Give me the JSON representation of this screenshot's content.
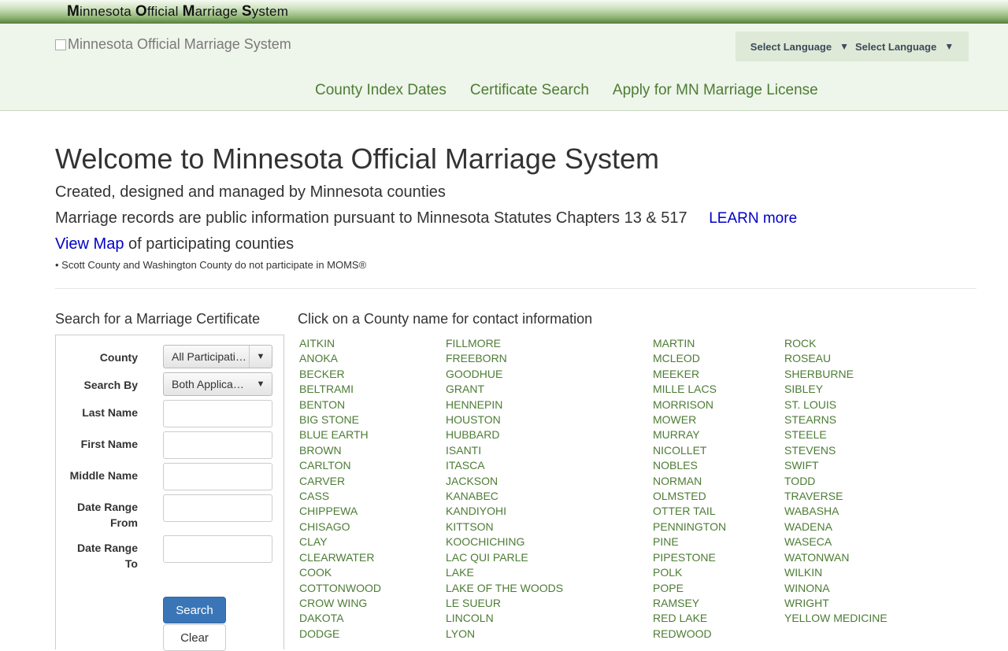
{
  "topbar": {
    "title_parts": [
      {
        "cap": "M",
        "rest": "innesota "
      },
      {
        "cap": "O",
        "rest": "fficial "
      },
      {
        "cap": "M",
        "rest": "arriage "
      },
      {
        "cap": "S",
        "rest": "ystem"
      }
    ]
  },
  "header": {
    "logo_alt": "Minnesota Official Marriage System",
    "language": {
      "select_1": "Select Language",
      "select_2": "Select Language"
    },
    "nav": [
      "County Index Dates",
      "Certificate Search",
      "Apply for MN Marriage License"
    ]
  },
  "welcome": {
    "title": "Welcome to Minnesota Official Marriage System",
    "line1": "Created, designed and managed by Minnesota counties",
    "line2": "Marriage records are public information pursuant to Minnesota Statutes Chapters 13 & 517",
    "learn_more": "LEARN more",
    "view_map": "View Map",
    "view_map_suffix": " of participating counties",
    "note": "• Scott County and Washington County do not participate in MOMS®"
  },
  "search": {
    "title": "Search for a Marriage Certificate",
    "county_label": "County",
    "county_value": "All Participating Counties",
    "search_by_label": "Search By",
    "search_by_value": "Both Applicants",
    "last_name_label": "Last Name",
    "first_name_label": "First Name",
    "middle_name_label": "Middle Name",
    "date_from_label_1": "Date Range",
    "date_from_label_2": "From",
    "date_to_label_1": "Date Range",
    "date_to_label_2": "To",
    "search_button": "Search",
    "clear_button": "Clear"
  },
  "counties": {
    "title": "Click on a County name for contact information",
    "columns": [
      [
        "AITKIN",
        "ANOKA",
        "BECKER",
        "BELTRAMI",
        "BENTON",
        "BIG STONE",
        "BLUE EARTH",
        "BROWN",
        "CARLTON",
        "CARVER",
        "CASS",
        "CHIPPEWA",
        "CHISAGO",
        "CLAY",
        "CLEARWATER",
        "COOK",
        "COTTONWOOD",
        "CROW WING",
        "DAKOTA",
        "DODGE"
      ],
      [
        "FILLMORE",
        "FREEBORN",
        "GOODHUE",
        "GRANT",
        "HENNEPIN",
        "HOUSTON",
        "HUBBARD",
        "ISANTI",
        "ITASCA",
        "JACKSON",
        "KANABEC",
        "KANDIYOHI",
        "KITTSON",
        "KOOCHICHING",
        "LAC QUI PARLE",
        "LAKE",
        "LAKE OF THE WOODS",
        "LE SUEUR",
        "LINCOLN",
        "LYON"
      ],
      [
        "MARTIN",
        "MCLEOD",
        "MEEKER",
        "MILLE LACS",
        "MORRISON",
        "MOWER",
        "MURRAY",
        "NICOLLET",
        "NOBLES",
        "NORMAN",
        "OLMSTED",
        "OTTER TAIL",
        "PENNINGTON",
        "PINE",
        "PIPESTONE",
        "POLK",
        "POPE",
        "RAMSEY",
        "RED LAKE",
        "REDWOOD"
      ],
      [
        "ROCK",
        "ROSEAU",
        "SHERBURNE",
        "SIBLEY",
        "ST. LOUIS",
        "STEARNS",
        "STEELE",
        "STEVENS",
        "SWIFT",
        "TODD",
        "TRAVERSE",
        "WABASHA",
        "WADENA",
        "WASECA",
        "WATONWAN",
        "WILKIN",
        "WINONA",
        "WRIGHT",
        "YELLOW MEDICINE"
      ]
    ]
  }
}
